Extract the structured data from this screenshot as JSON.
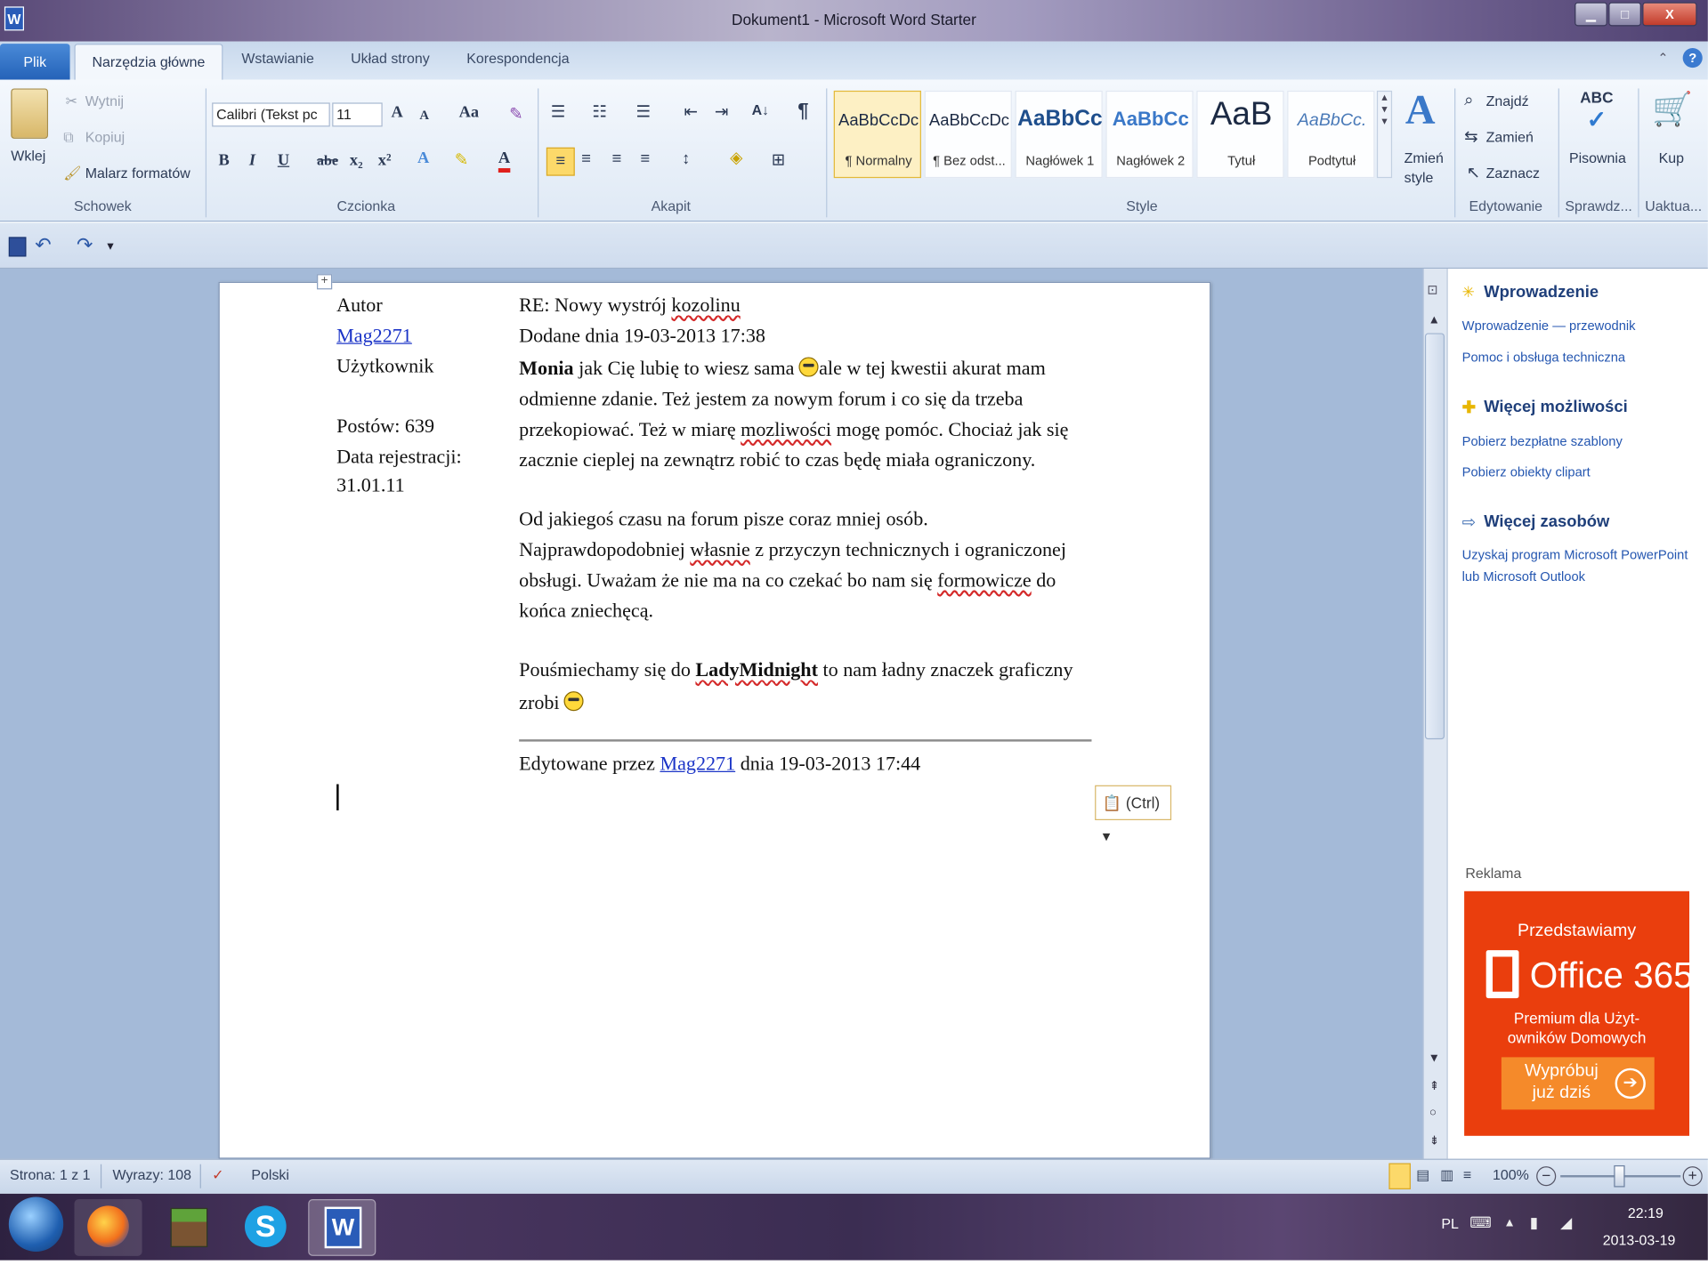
{
  "window": {
    "title": "Dokument1 - Microsoft Word Starter",
    "app_icon_letter": "W",
    "minimize": "▁",
    "maximize": "□",
    "close": "X"
  },
  "tabs": {
    "file": "Plik",
    "items": [
      "Narzędzia główne",
      "Wstawianie",
      "Układ strony",
      "Korespondencja"
    ],
    "help": "?"
  },
  "ribbon": {
    "clipboard": {
      "paste": "Wklej",
      "cut": "Wytnij",
      "copy": "Kopiuj",
      "format_painter": "Malarz formatów",
      "group": "Schowek"
    },
    "font": {
      "family": "Calibri (Tekst pc",
      "size": "11",
      "bold": "B",
      "italic": "I",
      "underline": "U",
      "strike": "abe",
      "subscript": "x₂",
      "superscript": "x²",
      "change_case": "Aa",
      "grow": "A",
      "shrink": "A",
      "text_effects": "A",
      "font_color": "A",
      "group": "Czcionka"
    },
    "paragraph": {
      "sort": "A↓",
      "show_marks": "¶",
      "group": "Akapit"
    },
    "styles": {
      "items": [
        {
          "sample": "AaBbCcDc",
          "name": "¶ Normalny"
        },
        {
          "sample": "AaBbCcDc",
          "name": "¶ Bez odst..."
        },
        {
          "sample": "AaBbCc",
          "name": "Nagłówek 1"
        },
        {
          "sample": "AaBbCc",
          "name": "Nagłówek 2"
        },
        {
          "sample": "AaB",
          "name": "Tytuł"
        },
        {
          "sample": "AaBbCc.",
          "name": "Podtytuł"
        }
      ],
      "change_styles_1": "Zmień",
      "change_styles_2": "style",
      "group": "Style"
    },
    "editing": {
      "find": "Znajdź",
      "replace": "Zamień",
      "select": "Zaznacz",
      "group": "Edytowanie"
    },
    "proofing": {
      "spelling": "Pisownia",
      "abc": "ABC",
      "group": "Sprawdz..."
    },
    "upgrade": {
      "buy": "Kup",
      "group": "Uaktua..."
    }
  },
  "document": {
    "author_label": "Autor",
    "author_name": "Mag2271",
    "author_role": "Użytkownik",
    "posts": "Postów: 639",
    "reg_label": "Data rejestracji:",
    "reg_date": "31.01.11",
    "post_title_prefix": "RE: Nowy wystrój ",
    "post_title_word": "kozolinu",
    "post_date": "Dodane dnia 19-03-2013 17:38",
    "p1_bold": "Monia",
    "p1_l1a": " jak Cię lubię to wiesz sama ",
    "p1_l1b": "ale w tej kwestii akurat mam",
    "p1_l2": "odmienne zdanie. Też jestem za nowym forum i co się da trzeba",
    "p1_l3a": "przekopiować. Też w miarę ",
    "p1_l3_word": "mozliwości",
    "p1_l3b": " mogę pomóc. Chociaż jak się",
    "p1_l4": "zacznie cieplej na zewnątrz robić to czas będę miała ograniczony.",
    "p2_l1": "Od jakiegoś czasu na forum pisze coraz mniej osób.",
    "p2_l2a": "Najprawdopodobniej ",
    "p2_l2_word": "własnie",
    "p2_l2b": " z przyczyn technicznych i ograniczonej",
    "p2_l3a": "obsługi. Uważam że nie ma na co czekać bo nam się ",
    "p2_l3_word": "formowicze",
    "p2_l3b": " do",
    "p2_l4": "końca zniechęcą.",
    "p3_l1a": "Pouśmiechamy się do ",
    "p3_l1_bold": "LadyMidnight",
    "p3_l1b": " to nam ładny znaczek graficzny",
    "p3_l2": "zrobi ",
    "edited_prefix": "Edytowane przez ",
    "edited_user": "Mag2271",
    "edited_suffix": " dnia 19-03-2013 17:44",
    "paste_options": "(Ctrl)"
  },
  "side_pane": {
    "intro_heading": "Wprowadzenie",
    "intro_links": [
      "Wprowadzenie — przewodnik",
      "Pomoc i obsługa techniczna"
    ],
    "more_heading": "Więcej możliwości",
    "more_links": [
      "Pobierz bezpłatne szablony",
      "Pobierz obiekty clipart"
    ],
    "resources_heading": "Więcej zasobów",
    "resources_links": [
      "Uzyskaj program Microsoft PowerPoint",
      "lub Microsoft Outlook"
    ],
    "ad_label": "Reklama",
    "ad": {
      "intro": "Przedstawiamy",
      "product": "Office 365",
      "tagline_1": "Premium dla Użyt-",
      "tagline_2": "owników Domowych",
      "cta_1": "Wypróbuj",
      "cta_2": "już dziś"
    }
  },
  "status": {
    "page": "Strona: 1 z 1",
    "words": "Wyrazy: 108",
    "language": "Polski",
    "zoom": "100%"
  },
  "taskbar": {
    "lang": "PL",
    "time": "22:19",
    "date": "2013-03-19"
  },
  "colors": {
    "accent": "#2462b8",
    "link": "#1a33c7",
    "ad_bg": "#ea3e0d"
  }
}
